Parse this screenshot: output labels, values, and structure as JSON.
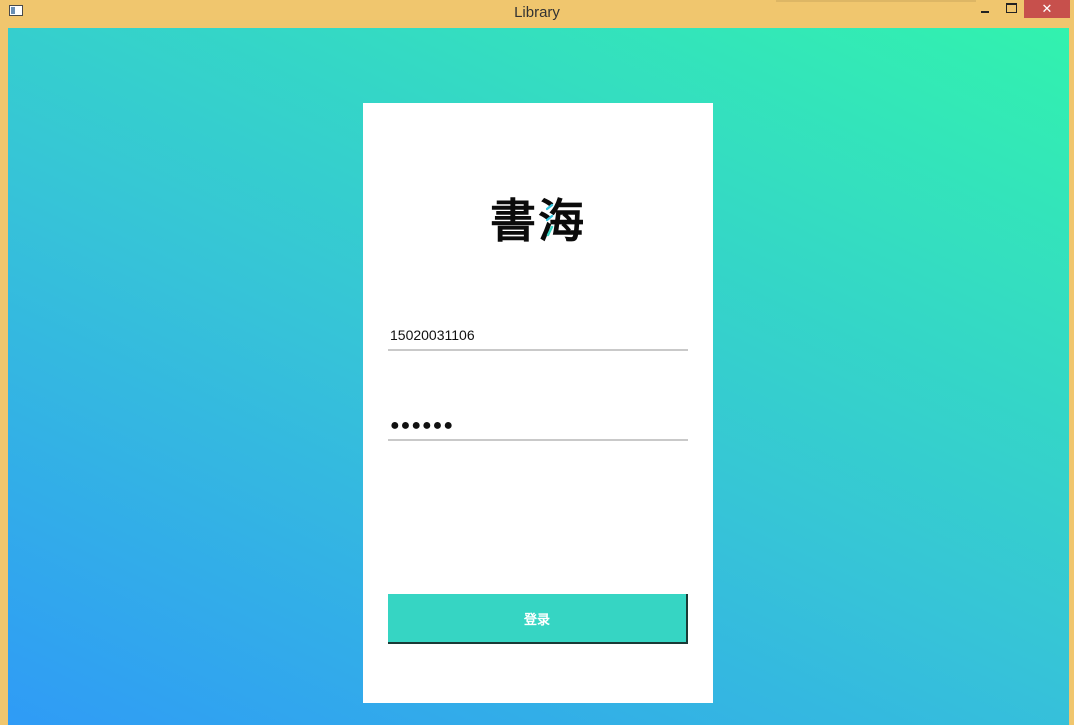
{
  "window": {
    "title": "Library",
    "close_glyph": "✕"
  },
  "colors": {
    "titlebar": "#f0c66e",
    "gradient_start": "#2f9bf6",
    "gradient_end": "#32f2ae",
    "button": "#36d5c3",
    "close": "#c7504c"
  },
  "logo": {
    "char1": "書",
    "char2": "海"
  },
  "login": {
    "username": "15020031106",
    "password_masked": "●●●●●●",
    "submit_label": "登录"
  },
  "icons": {
    "app": "app-window-icon",
    "minimize": "minimize-icon",
    "maximize": "maximize-icon",
    "close": "close-icon"
  }
}
